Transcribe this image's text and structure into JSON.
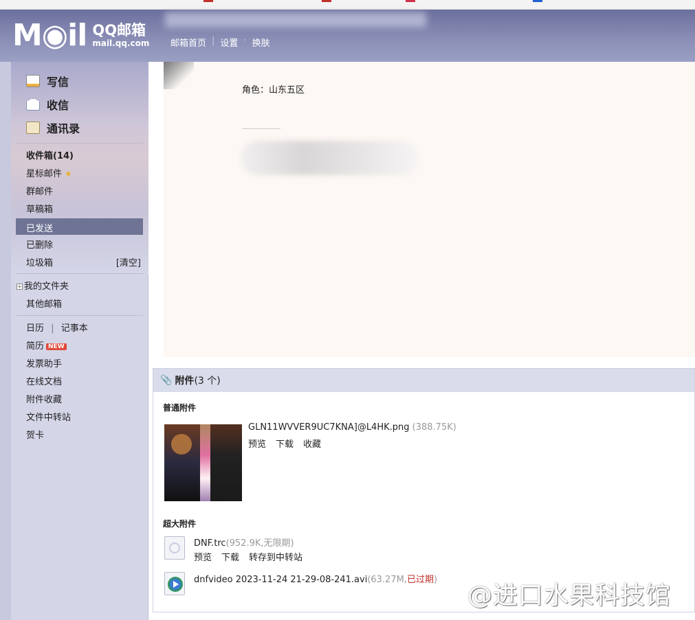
{
  "header": {
    "logo_mail": "M◉il",
    "logo_qq": "QQ邮箱",
    "logo_domain": "mail.qq.com",
    "nav": [
      "邮箱首页",
      "设置",
      "换肤"
    ]
  },
  "sidebar": {
    "compose": "写信",
    "receive": "收信",
    "contacts": "通讯录",
    "folders": [
      {
        "label": "收件箱(14)"
      },
      {
        "label": "星标邮件"
      },
      {
        "label": "群邮件"
      },
      {
        "label": "草稿箱"
      },
      {
        "label": "已发送"
      },
      {
        "label": "已删除"
      },
      {
        "label": "垃圾箱"
      }
    ],
    "clear": "[清空]",
    "my_folders": "我的文件夹",
    "other_mailbox": "其他邮箱",
    "calendar": "日历",
    "notes": "记事本",
    "tools": [
      {
        "label": "简历",
        "badge": "NEW"
      },
      {
        "label": "发票助手"
      },
      {
        "label": "在线文档"
      },
      {
        "label": "附件收藏"
      },
      {
        "label": "文件中转站"
      },
      {
        "label": "贺卡"
      }
    ]
  },
  "letter": {
    "role_line": "角色：山东五区"
  },
  "attachments": {
    "title": "附件",
    "count": "(3 个)",
    "normal_section": "普通附件",
    "large_section": "超大附件",
    "normal": [
      {
        "name": "GLN11WVVER9UC7KNA]@L4HK.png",
        "size": "(388.75K)",
        "actions": [
          "预览",
          "下载",
          "收藏"
        ]
      }
    ],
    "large": [
      {
        "name": "DNF.trc",
        "size": "(952.9K,无限期)",
        "actions": [
          "预览",
          "下载",
          "转存到中转站"
        ]
      },
      {
        "name": "dnfvideo 2023-11-24 21-29-08-241.avi",
        "size": "(63.27M,",
        "status": "已过期",
        "size_close": ")"
      }
    ]
  },
  "watermark": "@进口水果科技馆",
  "colors": {
    "header": "#7b7fa8",
    "sidebar": "#d4d6e8",
    "active_item": "#6f7394",
    "letter_bg": "#fdf8f4",
    "expired": "#c0302a"
  }
}
